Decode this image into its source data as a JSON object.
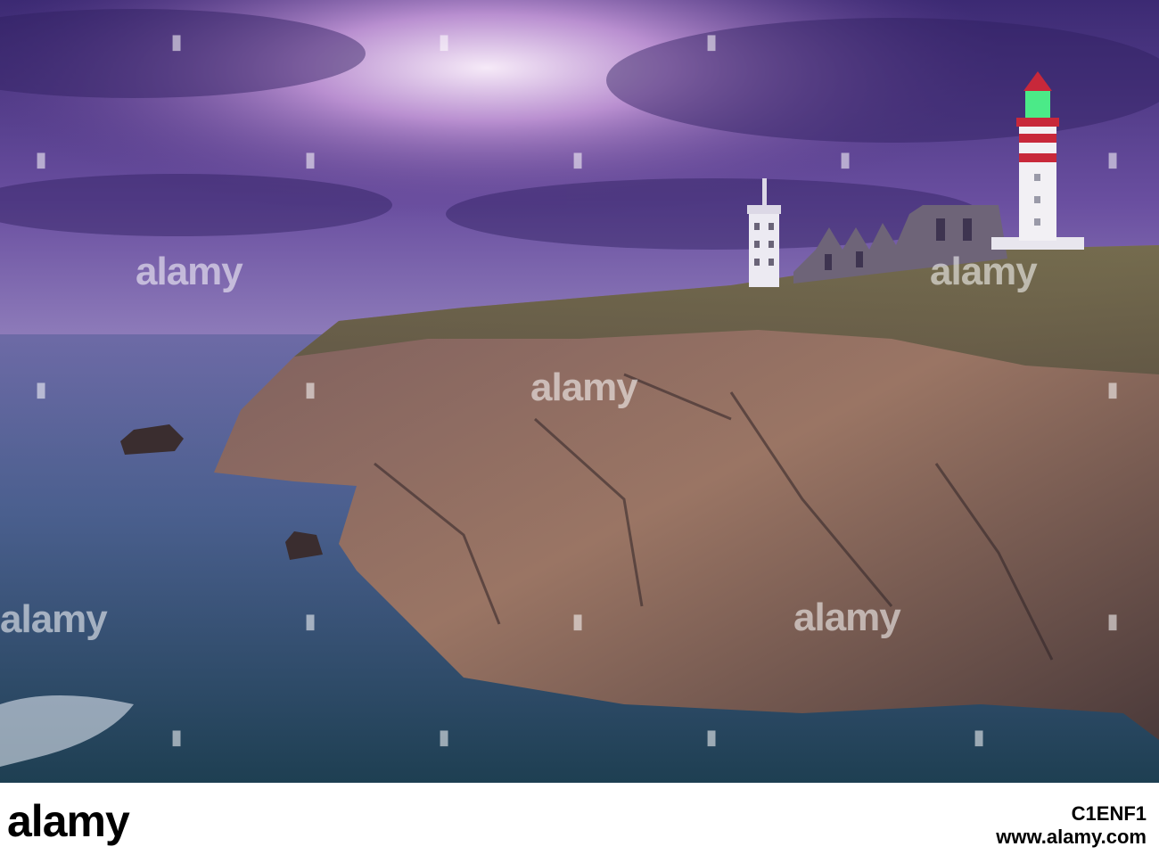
{
  "watermark": {
    "brand": "alamy",
    "site_lines": [
      "www.alamy.com",
      "C1ENF1"
    ]
  },
  "footer": {
    "logo": "alamy",
    "site": "www.alamy.com",
    "image_code": "C1ENF1"
  },
  "colors": {
    "sky_top": "#3a2a6e",
    "sky_glow": "#f2e4f7",
    "sea": "#2f4f73",
    "rock": "#8a6a5e",
    "lighthouse_red": "#c8283a",
    "light_green": "#4cff8a"
  }
}
